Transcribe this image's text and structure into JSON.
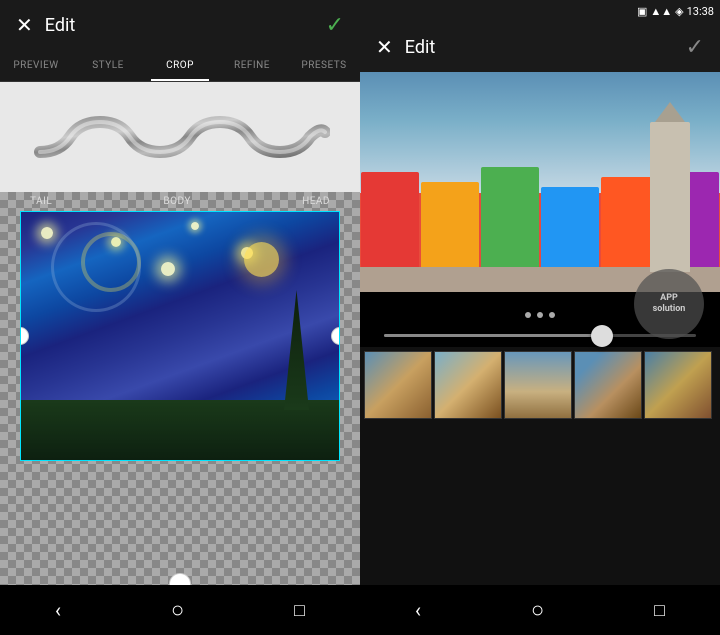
{
  "left": {
    "header": {
      "title": "Edit",
      "close_label": "✕",
      "confirm_label": "✓"
    },
    "tabs": [
      {
        "label": "PREVIEW",
        "active": false
      },
      {
        "label": "STYLE",
        "active": false
      },
      {
        "label": "CROP",
        "active": true
      },
      {
        "label": "REFINE",
        "active": false
      },
      {
        "label": "PRESETS",
        "active": false
      }
    ],
    "labels": {
      "tail": "TAIL",
      "body": "BODY",
      "head": "HEAD"
    }
  },
  "right": {
    "header": {
      "title": "Edit",
      "close_label": "✕",
      "confirm_label": "✓"
    },
    "status_bar": {
      "time": "13:38"
    },
    "watermark": {
      "line1": "APP",
      "line2": "solution"
    },
    "slider": {
      "fill_percent": 70
    }
  },
  "nav": {
    "back": "‹",
    "home": "○",
    "recent": "□"
  }
}
